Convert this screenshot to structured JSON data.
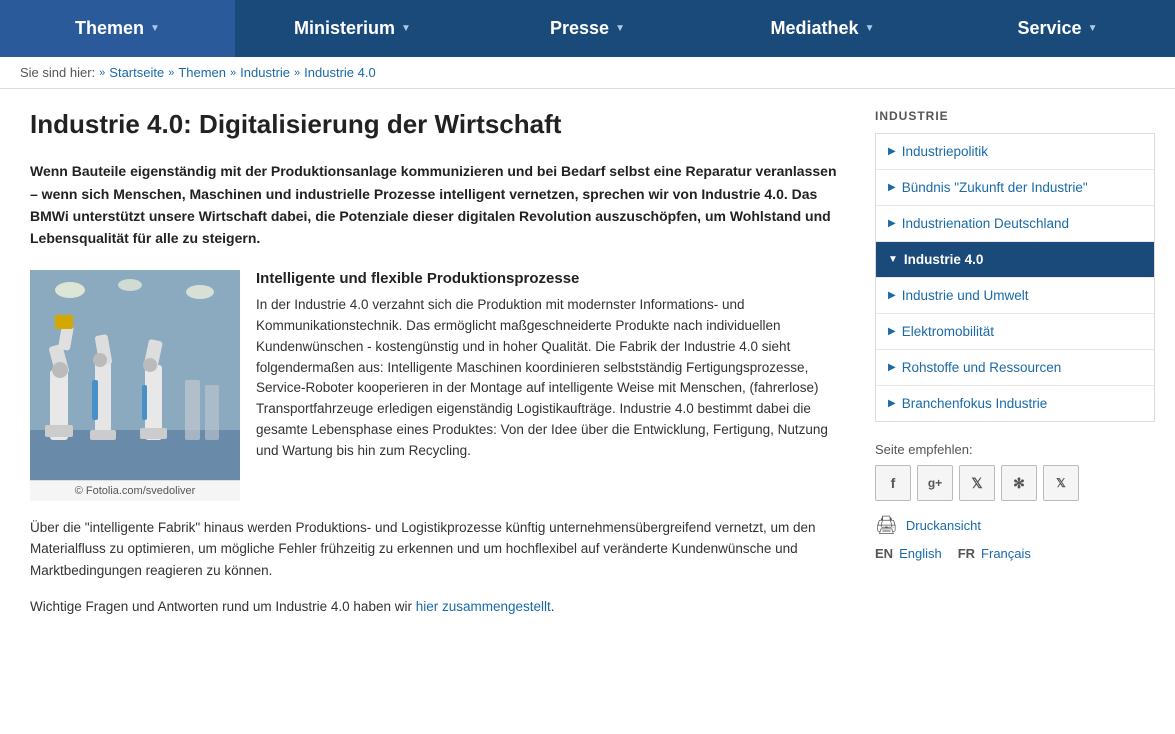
{
  "nav": {
    "items": [
      {
        "label": "Themen",
        "id": "themen"
      },
      {
        "label": "Ministerium",
        "id": "ministerium"
      },
      {
        "label": "Presse",
        "id": "presse"
      },
      {
        "label": "Mediathek",
        "id": "mediathek"
      },
      {
        "label": "Service",
        "id": "service"
      }
    ]
  },
  "breadcrumb": {
    "prefix": "Sie sind hier:",
    "items": [
      {
        "label": "Startseite",
        "href": "#"
      },
      {
        "label": "Themen",
        "href": "#"
      },
      {
        "label": "Industrie",
        "href": "#"
      },
      {
        "label": "Industrie 4.0",
        "href": "#"
      }
    ]
  },
  "content": {
    "title": "Industrie 4.0: Digitalisierung der Wirtschaft",
    "intro": "Wenn Bauteile eigenständig mit der Produktionsanlage kommunizieren und bei Bedarf selbst eine Reparatur veranlassen – wenn sich Menschen, Maschinen und industrielle Prozesse intelligent vernetzen, sprechen wir von Industrie 4.0. Das BMWi unterstützt unsere Wirtschaft dabei, die Potenziale dieser digitalen Revolution auszuschöpfen, um Wohlstand und Lebensqualität für alle zu steigern.",
    "image_caption": "© Fotolia.com/svedoliver",
    "section_heading": "Intelligente und flexible Produktionsprozesse",
    "section_text": "In der Industrie 4.0 verzahnt sich die Produktion mit modernster Informations- und Kommunikationstechnik. Das ermöglicht maßgeschneiderte Produkte nach individuellen Kundenwünschen - kostengünstig und in hoher Qualität. Die Fabrik der Industrie 4.0 sieht folgendermaßen aus: Intelligente Maschinen koordinieren selbstständig Fertigungsprozesse, Service-Roboter kooperieren in der Montage auf intelligente Weise mit Menschen, (fahrerlose) Transportfahrzeuge erledigen eigenständig Logistikaufträge. Industrie 4.0 bestimmt dabei die gesamte Lebensphase eines Produktes: Von der Idee über die Entwicklung, Fertigung, Nutzung und Wartung bis hin zum Recycling.",
    "body_text": "Über die \"intelligente Fabrik\" hinaus werden Produktions- und Logistikprozesse künftig unternehmensübergreifend vernetzt, um den Materialfluss zu optimieren, um mögliche Fehler frühzeitig zu erkennen und um hochflexibel auf veränderte Kundenwünsche und Marktbedingungen reagieren zu können.",
    "footer_text_before": "Wichtige Fragen und Antworten rund um Industrie 4.0 haben wir ",
    "footer_link": "hier zusammengestellt",
    "footer_text_after": "."
  },
  "sidebar": {
    "title": "INDUSTRIE",
    "menu_items": [
      {
        "label": "Industriepolitik",
        "active": false
      },
      {
        "label": "Bündnis \"Zukunft der Industrie\"",
        "active": false
      },
      {
        "label": "Industrienation Deutschland",
        "active": false
      },
      {
        "label": "Industrie 4.0",
        "active": true
      },
      {
        "label": "Industrie und Umwelt",
        "active": false
      },
      {
        "label": "Elektromobilität",
        "active": false
      },
      {
        "label": "Rohstoffe und Ressourcen",
        "active": false
      },
      {
        "label": "Branchenfokus Industrie",
        "active": false
      }
    ],
    "share_label": "Seite empfehlen:",
    "share_buttons": [
      {
        "label": "f",
        "title": "Facebook"
      },
      {
        "label": "g+",
        "title": "Google Plus"
      },
      {
        "label": "🐦",
        "title": "Twitter"
      },
      {
        "label": "✻",
        "title": "More"
      },
      {
        "label": "✕",
        "title": "Xing"
      }
    ],
    "print_label": "Druckansicht",
    "lang_en_code": "EN",
    "lang_en_label": "English",
    "lang_fr_code": "FR",
    "lang_fr_label": "Français"
  }
}
